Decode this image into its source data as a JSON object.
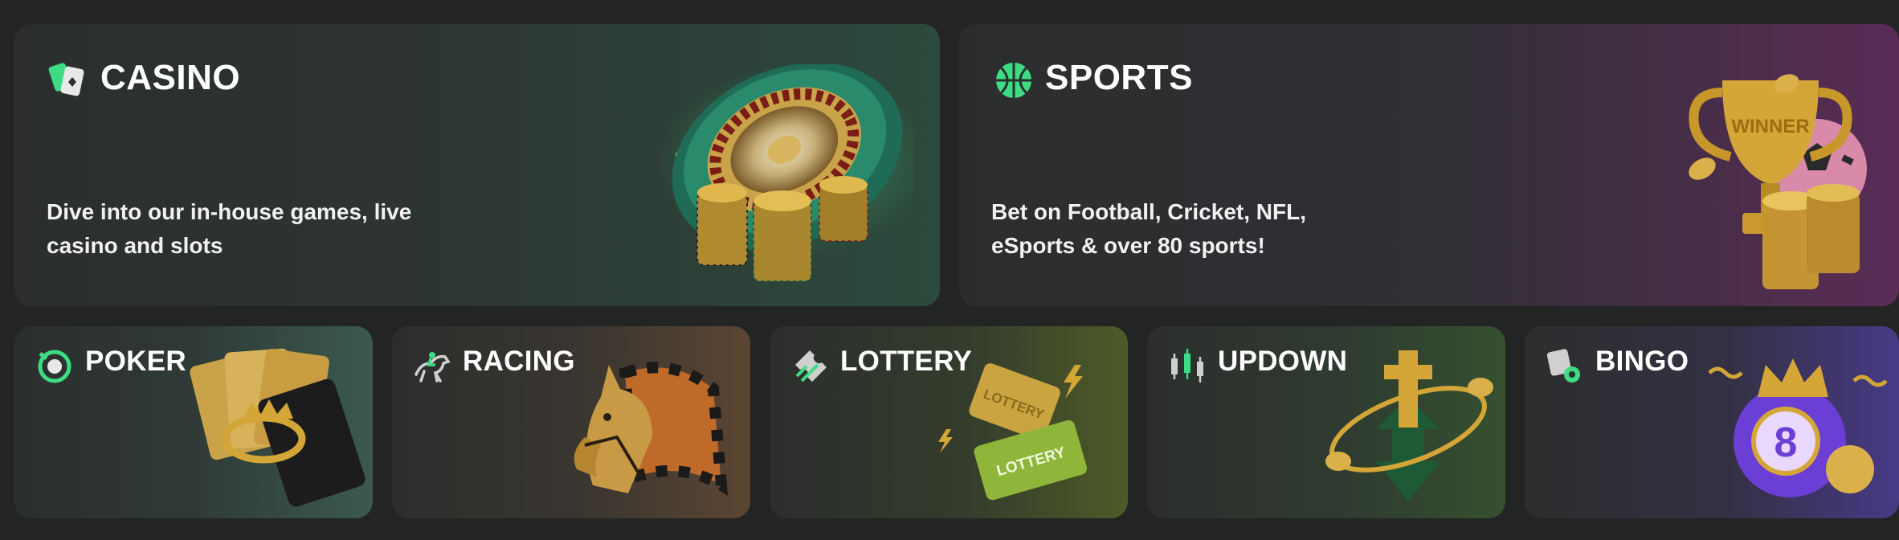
{
  "casino": {
    "title": "CASINO",
    "description_line1": "Dive into our in-house games, live",
    "description_line2": "casino and slots",
    "icon": "cards-icon",
    "art_icon": "roulette-chips-illustration"
  },
  "sports": {
    "title": "SPORTS",
    "description_line1": "Bet on Football, Cricket, NFL,",
    "description_line2": "eSports & over 80 sports!",
    "icon": "basketball-icon",
    "art_icon": "trophy-ball-illustration",
    "art_text": "WINNER"
  },
  "poker": {
    "title": "POKER",
    "icon": "poker-chip-icon",
    "art_icon": "playing-cards-illustration"
  },
  "racing": {
    "title": "RACING",
    "icon": "horse-rider-icon",
    "art_icon": "horse-flag-illustration"
  },
  "lottery": {
    "title": "LOTTERY",
    "icon": "ticket-icon",
    "art_icon": "lottery-tickets-illustration",
    "art_text": "LOTTERY"
  },
  "updown": {
    "title": "UPDOWN",
    "icon": "candlestick-icon",
    "art_icon": "arrows-ring-illustration"
  },
  "bingo": {
    "title": "BINGO",
    "icon": "bingo-card-icon",
    "art_icon": "bingo-ball-illustration",
    "art_text": "8"
  },
  "colors": {
    "accent_green": "#3ddc84",
    "gold": "#d4a637",
    "purple": "#6b3fd6"
  }
}
